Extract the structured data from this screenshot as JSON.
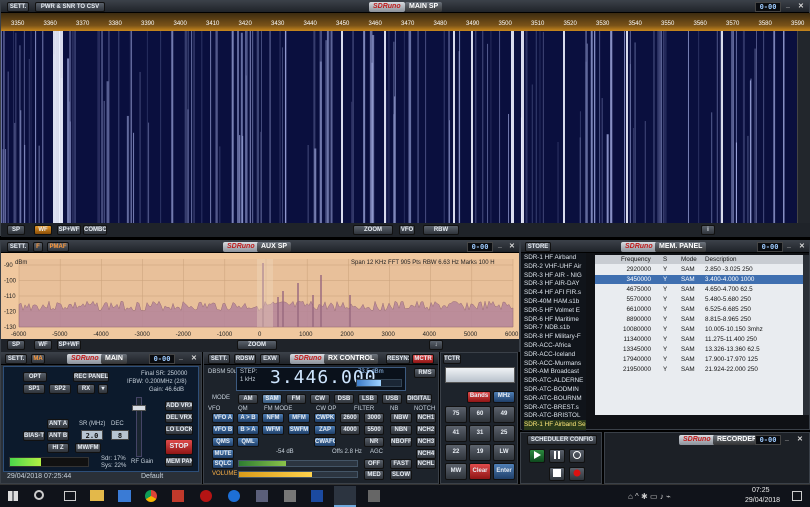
{
  "wf": {
    "sett": "SETT.",
    "pwr": "PWR & SNR TO CSV",
    "logo": "SDRuno",
    "sub": "MAIN SP",
    "ctrl": "0-00",
    "freqs": [
      "3350",
      "3360",
      "3370",
      "3380",
      "3390",
      "3400",
      "3410",
      "3420",
      "3430",
      "3440",
      "3450",
      "3460",
      "3470",
      "3480",
      "3490",
      "3500",
      "3510",
      "3520",
      "3530",
      "3540",
      "3550",
      "3560",
      "3570",
      "3580",
      "3590"
    ],
    "b": {
      "sp": "SP",
      "wf": "WF",
      "spwf": "SP+WF",
      "combo": "COMBO",
      "zoom": "ZOOM",
      "vfo": "VFO",
      "rbw": "RBW",
      "info": "i"
    }
  },
  "aux": {
    "sett": "SETT.",
    "f": "F",
    "pmaf": "PMAF",
    "logo": "SDRuno",
    "sub": "AUX SP",
    "ctrl": "0-00",
    "unit": "dBm",
    "info": "Span 12 KHz   FFT 905 Pts   RBW 6.63 Hz   Marks 100 H",
    "ylabels": [
      "-90",
      "-100",
      "-110",
      "-120",
      "-130"
    ],
    "xlabels": [
      "-6000",
      "-5000",
      "-4000",
      "-3000",
      "-2000",
      "-1000",
      "0",
      "1000",
      "2000",
      "3000",
      "4000",
      "5000",
      "6000"
    ],
    "b": {
      "sp": "SP",
      "wf": "WF",
      "spwf": "SP+WF",
      "zoom": "ZOOM",
      "down": "↓"
    }
  },
  "store": {
    "btn": "STORE",
    "logo": "SDRuno",
    "sub": "MEM. PANEL",
    "ctrl": "0-00",
    "lists": [
      "SDR-1 HF Airband",
      "SDR-2 VHF-UHF Air",
      "SDR-3 HF AIR - NIG",
      "SDR-3 HF AIR-DAY",
      "SDR-4 HF AFI FIR.s",
      "SDR-40M HAM.s1b",
      "SDR-5 HF Volmet E",
      "SDR-6 HF Maritime",
      "SDR-7 NDB.s1b",
      "SDR-8 HF Military-F",
      "SDR-ACC-Africa",
      "SDR-ACC-Iceland",
      "SDR-ACC-Murmans",
      "SDR-AM Broadcast",
      "SDR-ATC-ALDERNE",
      "SDR-ATC-BODMIN",
      "SDR-ATC-BOURNM",
      "SDR-ATC-BREST.s",
      "SDR-ATC-BRISTOL",
      "SDR-1 HF Airband Se"
    ],
    "headers": [
      "Frequency",
      "S",
      "Mode",
      "Description"
    ],
    "rows": [
      [
        "2920000",
        "Y",
        "SAM",
        "2.850 -3.025 250"
      ],
      [
        "3450000",
        "Y",
        "SAM",
        "3.400-4.000 1000"
      ],
      [
        "4675000",
        "Y",
        "SAM",
        "4.650-4.700 62.5"
      ],
      [
        "5570000",
        "Y",
        "SAM",
        "5.480-5.680 250"
      ],
      [
        "6610000",
        "Y",
        "SAM",
        "6.525-6.685 250"
      ],
      [
        "8890000",
        "Y",
        "SAM",
        "8.815-8.965 250"
      ],
      [
        "10080000",
        "Y",
        "SAM",
        "10.005-10.150 3mhz"
      ],
      [
        "11340000",
        "Y",
        "SAM",
        "11.275-11.400 250"
      ],
      [
        "13345000",
        "Y",
        "SAM",
        "13.326-13.360 62.5"
      ],
      [
        "17940000",
        "Y",
        "SAM",
        "17.900-17.970 125"
      ],
      [
        "21950000",
        "Y",
        "SAM",
        "21.924-22.000 250"
      ]
    ]
  },
  "main": {
    "sett": "SETT.",
    "ma": "MA",
    "logo": "SDRuno",
    "sub": "MAIN",
    "ctrl": "0-00",
    "opt": "OPT",
    "rec": "REC PANEL",
    "sp1": "SP1",
    "sp2": "SP2",
    "rx": "RX",
    "final": "Final SR: 250000",
    "ifbw": "IFBW: 0.200MHz (2/8)",
    "gain": "Gain: 46.6dB",
    "ant_a": "ANT A",
    "ant_b": "ANT B",
    "bias": "BIAS-T",
    "hi_z": "HI Z",
    "sr_lbl": "SR (MHz)",
    "sr_val": "2.0",
    "dec_lbl": "DEC",
    "dec_val": "8",
    "mw": "MW/FM",
    "addvrx": "ADD VRX",
    "delvrx": "DEL VRX",
    "lolock": "LO LOCK",
    "stop": "STOP",
    "mempan": "MEM PAN",
    "rfgain": "RF Gain",
    "sdr": "Sdr: 17%",
    "sys": "Sys: 22%",
    "date": "29/04/2018 07:25:44",
    "def": "Default"
  },
  "rx": {
    "sett": "SETT.",
    "rdsw": "RDSW",
    "exw": "EXW",
    "logo": "SDRuno",
    "sub": "RX CONTROL",
    "ctrl": "0-00",
    "resync": "RESYN1",
    "mctr": "MCTR",
    "tctr": "TCTR",
    "freq": "3.446.000",
    "dbm": "-73.5 dBm",
    "rms": "RMS",
    "step_lbl": "STEP:",
    "step_val": "1 kHz",
    "dbsm": "DBSM 50u",
    "mode_lbl": "MODE",
    "modes": [
      "AM",
      "SAM",
      "FM",
      "CW",
      "DSB",
      "LSB",
      "USB",
      "DIGITAL"
    ],
    "vfo_lbl": "VFO",
    "qm_lbl": "QM",
    "fmmode": "FM MODE",
    "cwop": "CW OP",
    "filter": "FILTER",
    "nb": "NB",
    "notch": "NOTCH",
    "vfoa": "VFO A",
    "vfob": "VFO B",
    "ab": "A > B",
    "ba": "B > A",
    "nfm": "NFM",
    "mfm": "MFM",
    "wfm": "WFM",
    "swfm": "SWFM",
    "cwpk": "CWPK",
    "zap": "ZAP",
    "cwafc": "CWAFC",
    "f2600": "2600",
    "f3000": "3000",
    "f4000": "4000",
    "f5500": "5500",
    "nbw": "NBW",
    "nbn": "NBN",
    "nr": "NR",
    "nboff": "NBOFF",
    "notch1": "NCH1",
    "notch2": "NCH2",
    "notch3": "NCH3",
    "notch4": "NCH4",
    "notchl": "NCHL",
    "qms": "QMS",
    "qml": "QML",
    "mute": "MUTE",
    "sqlc": "SQLC",
    "volume": "VOLUME",
    "db54": "-54 dB",
    "offs": "Offs 2.8 Hz",
    "agc": "AGC",
    "off": "OFF",
    "fast": "FAST",
    "med": "MED",
    "slow": "SLOW"
  },
  "keypad": {
    "bands": "Bands",
    "mhz": "MHz",
    "keys": [
      "75",
      "60",
      "49",
      "41",
      "31",
      "25",
      "22",
      "19",
      "LW",
      "MW",
      "Clear",
      "Enter"
    ]
  },
  "sched": {
    "title": "SCHEDULER CONFIG"
  },
  "recorder": {
    "logo": "SDRuno",
    "sub": "RECORDER",
    "ctrl": "0-00"
  },
  "taskbar": {
    "time": "07:25",
    "date": "29/04/2018"
  }
}
